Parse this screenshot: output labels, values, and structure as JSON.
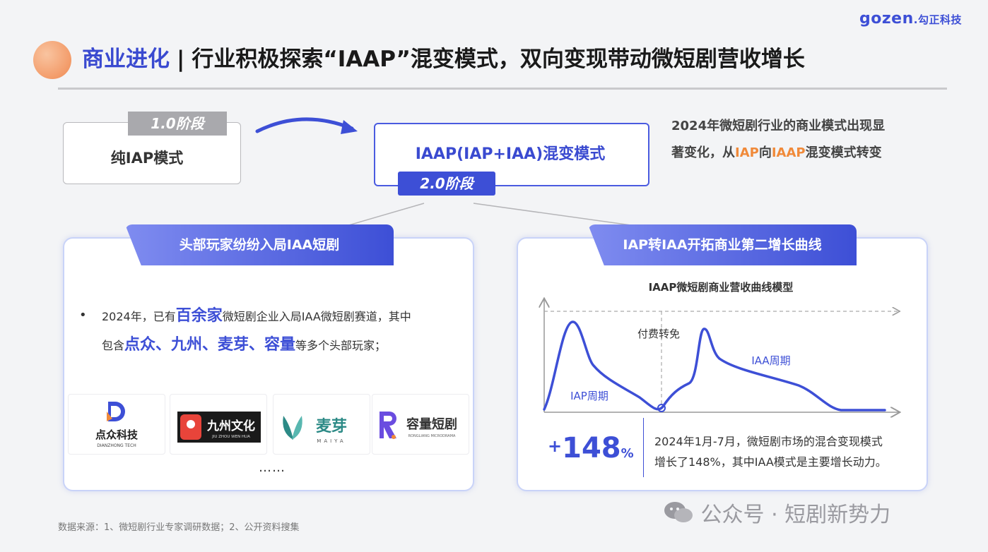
{
  "header": {
    "title_highlight": "商业进化",
    "title_separator": "|",
    "title_main": "行业积极探索“IAAP”混变模式，双向变现带动微短剧营收增长",
    "logo_brand": "gozen",
    "logo_cn": ".勾正科技"
  },
  "stages": {
    "stage1_tag": "1.0阶段",
    "stage1_text": "纯IAP模式",
    "stage2_text": "IAAP(IAP+IAA)混变模式",
    "stage2_tag": "2.0阶段"
  },
  "side_note": {
    "line1": "2024年微短剧行业的商业模式出现显",
    "line2_a": "著变化，从",
    "line2_b": "IAP",
    "line2_c": "向",
    "line2_d": "IAAP",
    "line2_e": "混变模式转变",
    "accent_color": "#f08a3a"
  },
  "left_panel": {
    "tab": "头部玩家纷纷入局IAA短剧",
    "bullet": "•",
    "t1": "2024年，已有",
    "t2": "百余家",
    "t3": "微短剧企业入局IAA微短剧赛道，其中",
    "t4": "包含",
    "t5": "点众、九州、麦芽、容量",
    "t6": "等多个头部玩家；",
    "logos": [
      {
        "name": "点众科技",
        "sub": "DIANZHONG TECH"
      },
      {
        "name": "九州文化",
        "sub": "JIU ZHOU WEN HUA"
      },
      {
        "name": "麦芽",
        "sub": "MAIYA"
      },
      {
        "name": "容量短剧",
        "sub": "RONGLIANG MICRODRAMA"
      }
    ],
    "ellipsis": "……"
  },
  "right_panel": {
    "tab": "IAP转IAA开拓商业第二增长曲线",
    "chart_title": "IAAP微短剧商业营收曲线模型",
    "label_switch": "付费转免",
    "label_iap": "IAP周期",
    "label_iaa": "IAA周期",
    "stat_plus": "+",
    "stat_num": "148",
    "stat_unit": "%",
    "stat_line1": "2024年1月-7月，微短剧市场的混合变现模式",
    "stat_line2": "增长了148%，其中IAA模式是主要增长动力。"
  },
  "footer": {
    "source": "数据来源：1、微短剧行业专家调研数据；2、公开资料搜集",
    "watermark": "公众号 · 短剧新势力"
  },
  "colors": {
    "accent_blue": "#3d4fd6",
    "accent_orange": "#f08a3a"
  }
}
